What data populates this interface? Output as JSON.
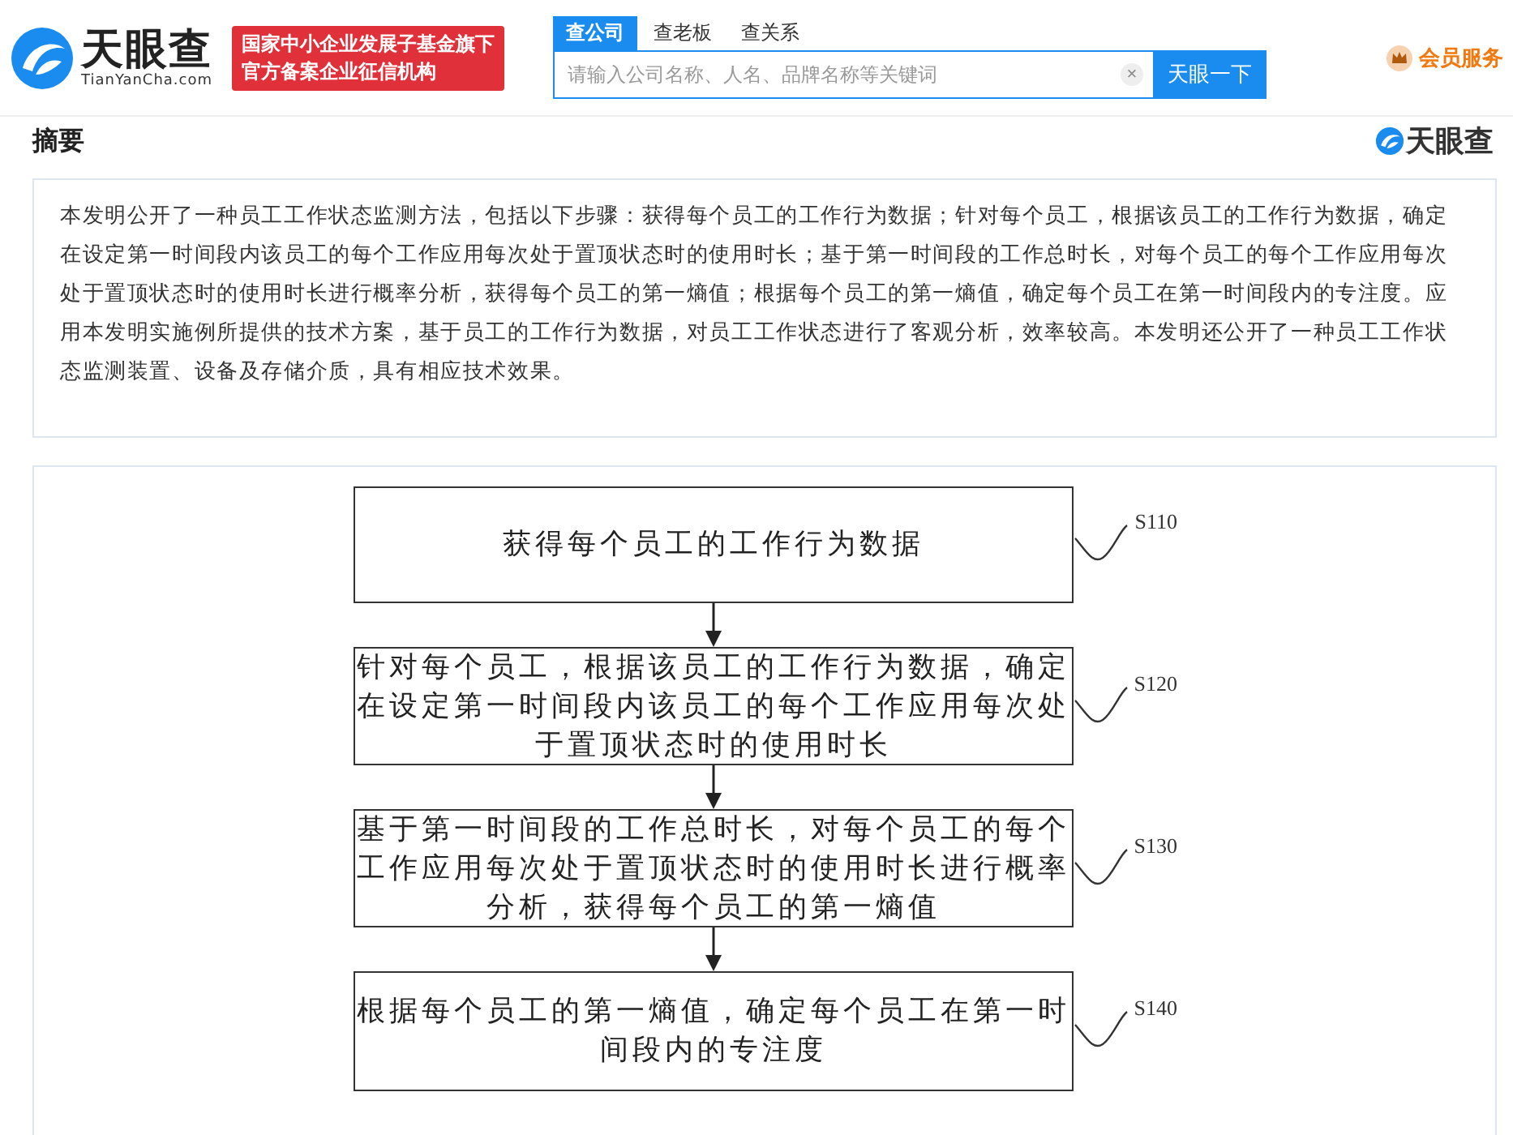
{
  "header": {
    "brand": "天眼查",
    "domain": "TianYanCha.com",
    "badge_lines": [
      "国家中小企业发展子基金旗下",
      "官方备案企业征信机构"
    ],
    "search_tabs": [
      {
        "label": "查公司",
        "selected": true
      },
      {
        "label": "查老板",
        "selected": false
      },
      {
        "label": "查关系",
        "selected": false
      }
    ],
    "search": {
      "placeholder": "请输入公司名称、人名、品牌名称等关键词",
      "clear": "×",
      "button": "天眼一下"
    },
    "vip": "会员服务"
  },
  "section": {
    "title": "摘要",
    "watermark_brand": "天眼查"
  },
  "abstract": "本发明公开了一种员工工作状态监测方法，包括以下步骤：获得每个员工的工作行为数据；针对每个员工，根据该员工的工作行为数据，确定在设定第一时间段内该员工的每个工作应用每次处于置顶状态时的使用时长；基于第一时间段的工作总时长，对每个员工的每个工作应用每次处于置顶状态时的使用时长进行概率分析，获得每个员工的第一熵值；根据每个员工的第一熵值，确定每个员工在第一时间段内的专注度。应用本发明实施例所提供的技术方案，基于员工的工作行为数据，对员工工作状态进行了客观分析，效率较高。本发明还公开了一种员工工作状态监测装置、设备及存储介质，具有相应技术效果。",
  "figure": {
    "steps": [
      {
        "lines": [
          "获得每个员工的工作行为数据"
        ],
        "label": "S110"
      },
      {
        "lines": [
          "针对每个员工，根据该员工的工作行为数据，确定",
          "在设定第一时间段内该员工的每个工作应用每次处",
          "于置顶状态时的使用时长"
        ],
        "label": "S120"
      },
      {
        "lines": [
          "基于第一时间段的工作总时长，对每个员工的每个",
          "工作应用每次处于置顶状态时的使用时长进行概率",
          "分析，获得每个员工的第一熵值"
        ],
        "label": "S130"
      },
      {
        "lines": [
          "根据每个员工的第一熵值，确定每个员工在第一时",
          "间段内的专注度"
        ],
        "label": "S140"
      }
    ]
  }
}
